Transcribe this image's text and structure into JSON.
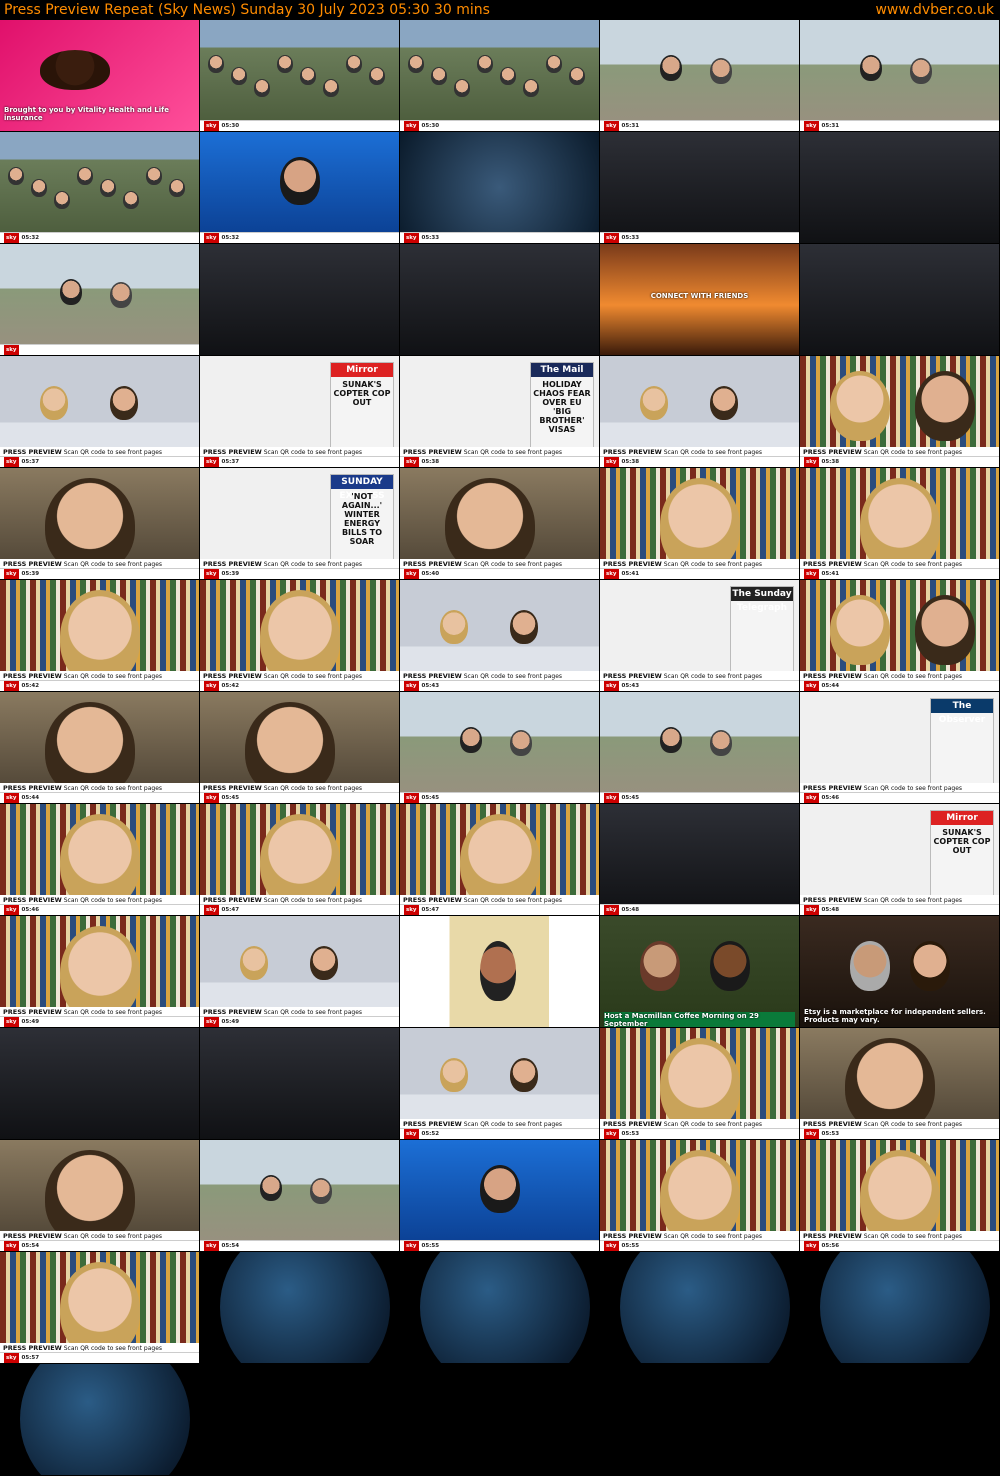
{
  "header": {
    "title": "Press Preview Repeat (Sky News)    Sunday 30 July 2023  05:30  30 mins",
    "site": "www.dvber.co.uk"
  },
  "strings": {
    "vitality": "Brought to you by Vitality Health and Life insurance",
    "press_preview": "PRESS PREVIEW",
    "qr": "Scan QR code to see front pages",
    "sky": "sky",
    "mirror": "Mirror",
    "mirror_head": "SUNAK'S COPTER COP OUT",
    "mail": "The Mail",
    "mail_head": "HOLIDAY CHAOS FEAR OVER EU 'BIG BROTHER' VISAS",
    "express": "SUNDAY EXPRESS",
    "express_head": "'NOT AGAIN...' WINTER ENERGY BILLS TO SOAR",
    "observer": "The Observer",
    "telegraph": "The Sunday Telegraph",
    "connect": "CONNECT WITH FRIENDS",
    "macmillan": "Host a Macmillan Coffee Morning on 29 September",
    "etsy": "Etsy is a marketplace for independent sellers. Products may vary."
  },
  "thumbnails": [
    {
      "type": "ad_dog",
      "time": ""
    },
    {
      "type": "crowd",
      "time": "05:30"
    },
    {
      "type": "crowd",
      "time": "05:30"
    },
    {
      "type": "outdoor",
      "time": "05:31"
    },
    {
      "type": "outdoor",
      "time": "05:31"
    },
    {
      "type": "crowd",
      "time": "05:32"
    },
    {
      "type": "presenter",
      "time": "05:32"
    },
    {
      "type": "weather",
      "time": "05:33"
    },
    {
      "type": "dark",
      "time": "05:33"
    },
    {
      "type": "dark",
      "time": ""
    },
    {
      "type": "outdoor",
      "time": ""
    },
    {
      "type": "dark",
      "time": ""
    },
    {
      "type": "dark",
      "time": ""
    },
    {
      "type": "connect",
      "time": ""
    },
    {
      "type": "dark",
      "time": ""
    },
    {
      "type": "studio",
      "time": "05:37"
    },
    {
      "type": "paper_mirror",
      "time": "05:37"
    },
    {
      "type": "paper_mail",
      "time": "05:38"
    },
    {
      "type": "studio",
      "time": "05:38"
    },
    {
      "type": "two_guests",
      "time": "05:38"
    },
    {
      "type": "man",
      "time": "05:39"
    },
    {
      "type": "paper_express",
      "time": "05:39"
    },
    {
      "type": "man",
      "time": "05:40"
    },
    {
      "type": "woman",
      "time": "05:41"
    },
    {
      "type": "woman",
      "time": "05:41"
    },
    {
      "type": "woman",
      "time": "05:42"
    },
    {
      "type": "woman",
      "time": "05:42"
    },
    {
      "type": "studio",
      "time": "05:43"
    },
    {
      "type": "paper_telegraph",
      "time": "05:43"
    },
    {
      "type": "two_guests",
      "time": "05:44"
    },
    {
      "type": "man",
      "time": "05:44"
    },
    {
      "type": "man",
      "time": "05:45"
    },
    {
      "type": "outdoor",
      "time": "05:45"
    },
    {
      "type": "outdoor",
      "time": "05:45"
    },
    {
      "type": "paper_observer",
      "time": "05:46"
    },
    {
      "type": "woman",
      "time": "05:46"
    },
    {
      "type": "woman",
      "time": "05:47"
    },
    {
      "type": "woman",
      "time": "05:47"
    },
    {
      "type": "dark",
      "time": "05:48"
    },
    {
      "type": "paper_mirror",
      "time": "05:48"
    },
    {
      "type": "woman",
      "time": "05:49"
    },
    {
      "type": "studio",
      "time": "05:49"
    },
    {
      "type": "ad_light",
      "time": ""
    },
    {
      "type": "macmillan",
      "time": ""
    },
    {
      "type": "etsy",
      "time": ""
    },
    {
      "type": "dark",
      "time": ""
    },
    {
      "type": "dark",
      "time": ""
    },
    {
      "type": "studio",
      "time": "05:52"
    },
    {
      "type": "woman",
      "time": "05:53"
    },
    {
      "type": "man",
      "time": "05:53"
    },
    {
      "type": "man",
      "time": "05:54"
    },
    {
      "type": "outdoor",
      "time": "05:54"
    },
    {
      "type": "presenter",
      "time": "05:55"
    },
    {
      "type": "woman",
      "time": "05:55"
    },
    {
      "type": "woman",
      "time": "05:56"
    },
    {
      "type": "woman",
      "time": "05:57"
    },
    {
      "type": "globe",
      "time": ""
    },
    {
      "type": "globe",
      "time": ""
    },
    {
      "type": "globe",
      "time": ""
    },
    {
      "type": "globe",
      "time": ""
    },
    {
      "type": "globe",
      "time": ""
    }
  ]
}
